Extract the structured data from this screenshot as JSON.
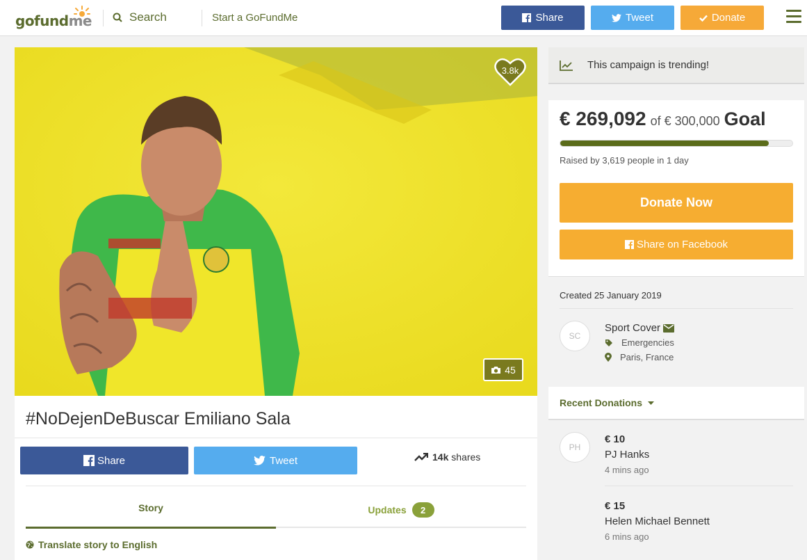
{
  "header": {
    "logo_main": "gofund",
    "logo_tail": "me",
    "search_label": "Search",
    "start_label": "Start a GoFundMe",
    "share_label": "Share",
    "tweet_label": "Tweet",
    "donate_label": "Donate"
  },
  "campaign": {
    "hearts": "3.8k",
    "photo_count": "45",
    "title": "#NoDejenDeBuscar Emiliano Sala",
    "share_label": "Share",
    "tweet_label": "Tweet",
    "shares_count": "14k",
    "shares_suffix": " shares",
    "tabs": {
      "story": "Story",
      "updates": "Updates",
      "updates_count": "2"
    },
    "translate_label": "Translate story to English"
  },
  "sidebar": {
    "trending": "This campaign is trending!",
    "raised": "€ 269,092",
    "of_goal": "of € 300,000",
    "goal_label": "Goal",
    "progress_fraction": 0.897,
    "raised_by": "Raised by 3,619 people in 1 day",
    "donate_now": "Donate Now",
    "share_facebook": "Share on Facebook",
    "created": "Created 25 January 2019",
    "organizer": {
      "initials": "SC",
      "name": "Sport Cover",
      "category": "Emergencies",
      "location": "Paris, France"
    },
    "recent_label": "Recent Donations",
    "donations": [
      {
        "initials": "PH",
        "amount": "€ 10",
        "name": "PJ Hanks",
        "time": "4 mins ago"
      },
      {
        "initials": "",
        "amount": "€ 15",
        "name": "Helen Michael Bennett",
        "time": "6 mins ago"
      }
    ]
  },
  "colors": {
    "brand_green": "#5b6c2e",
    "facebook": "#3b5998",
    "twitter": "#55acee",
    "donate": "#f6ad31"
  }
}
